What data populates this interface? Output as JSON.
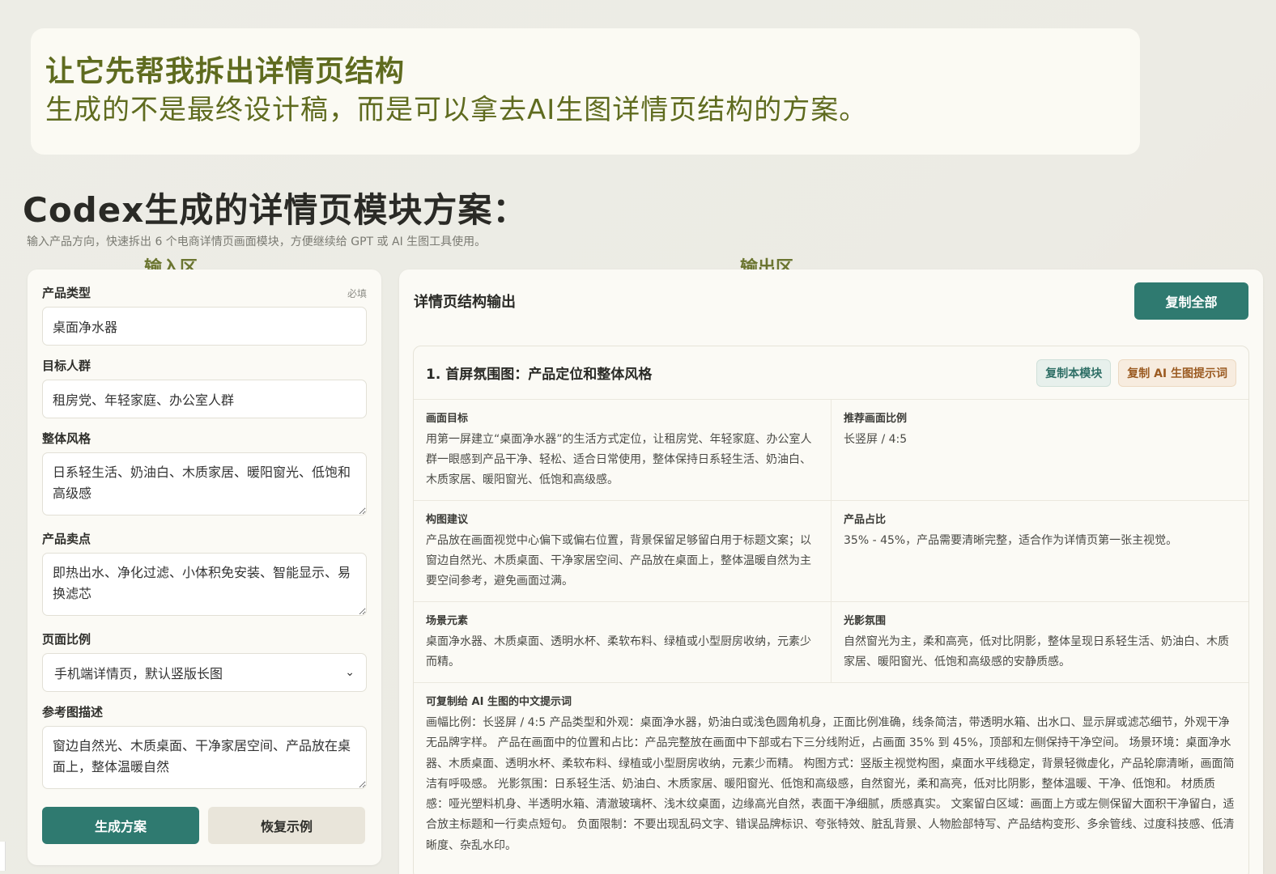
{
  "intro": {
    "title": "让它先帮我拆出详情页结构",
    "subtitle": "生成的不是最终设计稿，而是可以拿去AI生图详情页结构的方案。"
  },
  "page": {
    "title": "Codex生成的详情页模块方案：",
    "description": "输入产品方向，快速拆出 6 个电商详情页画面模块，方便继续给 GPT 或 AI 生图工具使用。",
    "input_zone_label": "输入区",
    "output_zone_label": "输出区"
  },
  "input": {
    "fields": [
      {
        "label": "产品类型",
        "required": "必填",
        "value": "桌面净水器"
      },
      {
        "label": "目标人群",
        "value": "租房党、年轻家庭、办公室人群"
      },
      {
        "label": "整体风格",
        "value": "日系轻生活、奶油白、木质家居、暖阳窗光、低饱和高级感"
      },
      {
        "label": "产品卖点",
        "value": "即热出水、净化过滤、小体积免安装、智能显示、易换滤芯"
      },
      {
        "label": "页面比例",
        "value": "手机端详情页，默认竖版长图"
      },
      {
        "label": "参考图描述",
        "value": "窗边自然光、木质桌面、干净家居空间、产品放在桌面上，整体温暖自然"
      }
    ],
    "generate_label": "生成方案",
    "reset_label": "恢复示例"
  },
  "output": {
    "title": "详情页结构输出",
    "copy_all_label": "复制全部",
    "module": {
      "title": "1. 首屏氛围图：产品定位和整体风格",
      "copy_module_label": "复制本模块",
      "copy_prompt_label": "复制 AI 生图提示词",
      "cells": [
        {
          "label": "画面目标",
          "text": "用第一屏建立“桌面净水器”的生活方式定位，让租房党、年轻家庭、办公室人群一眼感到产品干净、轻松、适合日常使用，整体保持日系轻生活、奶油白、木质家居、暖阳窗光、低饱和高级感。"
        },
        {
          "label": "推荐画面比例",
          "text": "长竖屏 / 4:5"
        },
        {
          "label": "构图建议",
          "text": "产品放在画面视觉中心偏下或偏右位置，背景保留足够留白用于标题文案；以窗边自然光、木质桌面、干净家居空间、产品放在桌面上，整体温暖自然为主要空间参考，避免画面过满。"
        },
        {
          "label": "产品占比",
          "text": "35% - 45%，产品需要清晰完整，适合作为详情页第一张主视觉。"
        },
        {
          "label": "场景元素",
          "text": "桌面净水器、木质桌面、透明水杯、柔软布料、绿植或小型厨房收纳，元素少而精。"
        },
        {
          "label": "光影氛围",
          "text": "自然窗光为主，柔和高亮，低对比阴影，整体呈现日系轻生活、奶油白、木质家居、暖阳窗光、低饱和高级感的安静质感。"
        }
      ],
      "prompt_label": "可复制给 AI 生图的中文提示词",
      "prompt_text": "画幅比例：长竖屏 / 4:5 产品类型和外观：桌面净水器，奶油白或浅色圆角机身，正面比例准确，线条简洁，带透明水箱、出水口、显示屏或滤芯细节，外观干净无品牌字样。 产品在画面中的位置和占比：产品完整放在画面中下部或右下三分线附近，占画面 35% 到 45%，顶部和左侧保持干净空间。 场景环境：桌面净水器、木质桌面、透明水杯、柔软布料、绿植或小型厨房收纳，元素少而精。 构图方式：竖版主视觉构图，桌面水平线稳定，背景轻微虚化，产品轮廓清晰，画面简洁有呼吸感。 光影氛围：日系轻生活、奶油白、木质家居、暖阳窗光、低饱和高级感，自然窗光，柔和高亮，低对比阴影，整体温暖、干净、低饱和。 材质质感：哑光塑料机身、半透明水箱、清澈玻璃杯、浅木纹桌面，边缘高光自然，表面干净细腻，质感真实。 文案留白区域：画面上方或左侧保留大面积干净留白，适合放主标题和一行卖点短句。 负面限制：不要出现乱码文字、错误品牌标识、夸张特效、脏乱背景、人物脸部特写、产品结构变形、多余管线、过度科技感、低清晰度、杂乱水印。"
    }
  }
}
